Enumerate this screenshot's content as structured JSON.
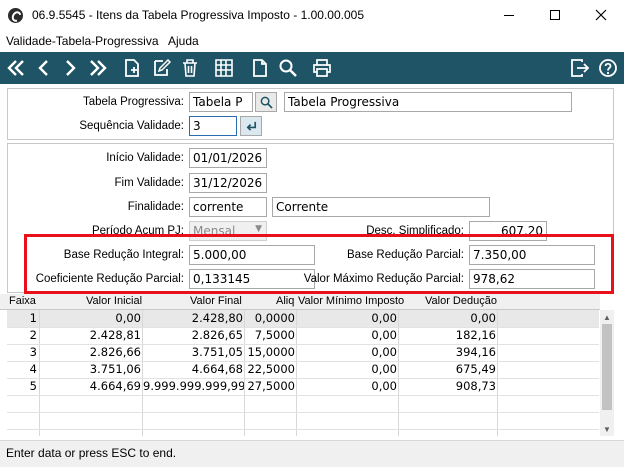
{
  "window": {
    "title": "06.9.5545 - Itens da Tabela Progressiva Imposto - 1.00.00.005"
  },
  "menu": {
    "items": [
      "Validade-Tabela-Progressiva",
      "Ajuda"
    ]
  },
  "toolbar": {
    "buttons": [
      "first-icon",
      "previous-icon",
      "next-icon",
      "last-icon",
      "new-icon",
      "edit-icon",
      "delete-icon",
      "grid-icon",
      "document-icon",
      "search-icon",
      "print-icon",
      "exit-icon",
      "help-icon"
    ]
  },
  "header": {
    "tabela_label": "Tabela Progressiva:",
    "tabela_code": "Tabela P",
    "tabela_desc": "Tabela Progressiva",
    "sequencia_label": "Sequência Validade:",
    "sequencia_value": "3"
  },
  "details": {
    "inicio_label": "Início Validade:",
    "inicio_value": "01/01/2026",
    "fim_label": "Fim Validade:",
    "fim_value": "31/12/2026",
    "finalidade_label": "Finalidade:",
    "finalidade_code": "corrente",
    "finalidade_desc": "Corrente",
    "periodo_label": "Período Acum PJ:",
    "periodo_value": "Mensal",
    "desc_simpl_label": "Desc. Simplificado:",
    "desc_simpl_value": "607,20",
    "base_integral_label": "Base Redução Integral:",
    "base_integral_value": "5.000,00",
    "base_parcial_label": "Base Redução Parcial:",
    "base_parcial_value": "7.350,00",
    "coef_label": "Coeficiente Redução Parcial:",
    "coef_value": "0,133145",
    "valor_max_label": "Valor Máximo Redução Parcial:",
    "valor_max_value": "978,62"
  },
  "grid": {
    "columns": [
      "Faixa",
      "Valor Inicial",
      "Valor Final",
      "Aliq",
      "Valor Mínimo Imposto",
      "Valor Dedução"
    ],
    "rows": [
      [
        "1",
        "0,00",
        "2.428,80",
        "0,0000",
        "0,00",
        "0,00"
      ],
      [
        "2",
        "2.428,81",
        "2.826,65",
        "7,5000",
        "0,00",
        "182,16"
      ],
      [
        "3",
        "2.826,66",
        "3.751,05",
        "15,0000",
        "0,00",
        "394,16"
      ],
      [
        "4",
        "3.751,06",
        "4.664,68",
        "22,5000",
        "0,00",
        "675,49"
      ],
      [
        "5",
        "4.664,69",
        "9.999.999.999,99",
        "27,5000",
        "0,00",
        "908,73"
      ]
    ]
  },
  "status": {
    "text": "Enter data or press ESC to end."
  }
}
